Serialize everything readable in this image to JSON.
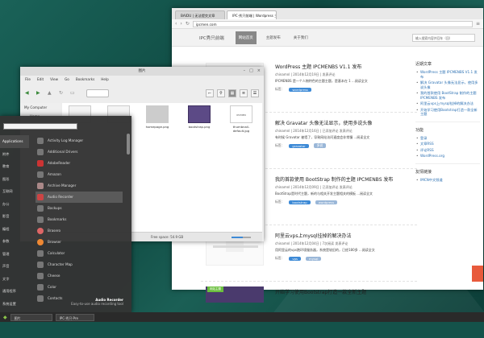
{
  "browser": {
    "tabs": [
      "BAIDU | 无法提交文章",
      "IPC·秀只前端 | Wordpress 主题"
    ],
    "url": "ipcmen.com",
    "site": {
      "logo": "IPC秀只前端",
      "nav": [
        "网站首页",
        "主题发布",
        "关于我们"
      ],
      "search_placeholder": "输入搜索内容并回车（回）"
    },
    "posts": [
      {
        "title": "WordPress 主题 IPCMENBS V1.1 发布",
        "meta": "chinamnl | 2014年12月19日 | 发表评论",
        "excerpt": "IPCMENBS 是一个人物特色的主题主题，是基本在 1 ...阅读全文",
        "tags_label": "标签：",
        "tags": [
          "wordpress"
        ]
      },
      {
        "title": "解决 Gravatar 头像无法显示，使用多说头像",
        "meta": "chinamnl | 2014年12月16日 | 已添加评论 发表评论",
        "excerpt": "有时候 Gravatar 被墙了，导致网站访问速度会非常慢 ...阅读全文",
        "tags_label": "标签：",
        "tags": [
          "gravatar",
          "多说"
        ]
      },
      {
        "title": "我的首款使用 BootStrap 制作的主题 IPCMENBS 发布",
        "meta": "chinamnl | 2014年12月09日 | 已添加评论 发表评论",
        "excerpt": "BootStrap是时代主题，新的与相关开发主题相关的模板 ...阅读全文",
        "tags_label": "标签：",
        "tags": [
          "bootstrap",
          "wordpress"
        ]
      },
      {
        "title": "阿里云vps上mysql挂掉的解决办法",
        "meta": "chinamnl | 2014年12月04日 | 7次阅读 发表评论",
        "excerpt": "用阿里云的vps跑环境服务器，系统是较旧的，已经180多 ...阅读全文",
        "tags_label": "标签：",
        "tags": [
          "vps",
          "mysql"
        ]
      },
      {
        "title": "开始学习使用Bootstrap打造一款全新主题",
        "label": "网站主题"
      }
    ],
    "sidebar": {
      "recent_title": "近期文章",
      "recent": [
        "WordPress 主题 IPCMENBS V1.1 发布",
        "解决 Gravatar 头像无法显示，使用多说头像",
        "我的首款使用 BootStrap 制作的主题 IPCMENBS 发布",
        "阿里云vps上mysql挂掉的解决办法",
        "开始学习使用Bootstrap打造一款全新主题"
      ],
      "func_title": "功能",
      "func": [
        "登录",
        "文章RSS",
        "评论RSS",
        "WordPress.org"
      ],
      "links_title": "友情链接",
      "links": [
        "IMCN中文频道"
      ]
    }
  },
  "filemanager": {
    "title": "图片",
    "menu": [
      "File",
      "Edit",
      "View",
      "Go",
      "Bookmarks",
      "Help"
    ],
    "sidebar_header": "My Computer",
    "sidebar_items": [
      "Home"
    ],
    "files": [
      {
        "name": "",
        "style": "blank"
      },
      {
        "name": "",
        "style": "blank"
      },
      {
        "name": "homepage.png",
        "style": "screen"
      },
      {
        "name": "bootstrap.png",
        "style": "purple"
      },
      {
        "name": "thumbnail-default.jpg",
        "style": "doc"
      }
    ],
    "file_icon_text": "IPCMEN",
    "status": "Free space: 54.9 GB",
    "window_controls": [
      "–",
      "□",
      "×"
    ]
  },
  "appmenu": {
    "categories": [
      "Applications",
      "附件",
      "教育",
      "图形",
      "互联网",
      "办公",
      "影音",
      "编程",
      "参数",
      "管理",
      "声音",
      "文字",
      "通用程序",
      "系统设置",
      "系统管理",
      "Places",
      "Recent Files"
    ],
    "apps": [
      "Activity Log Manager",
      "Additional Drivers",
      "AdobeReader",
      "Amazon",
      "Archive Manager",
      "Audio Recorder",
      "Backups",
      "Bookmarks",
      "Brasero",
      "Browser",
      "Calculator",
      "Character Map",
      "Cheese",
      "Color",
      "Contacts"
    ],
    "selected_app": "Audio Recorder",
    "desc_name": "Audio Recorder",
    "desc_text": "Easy-to-use audio recording tool"
  },
  "taskbar": {
    "items": [
      "图片",
      "IPC·秀只·Pre"
    ]
  }
}
